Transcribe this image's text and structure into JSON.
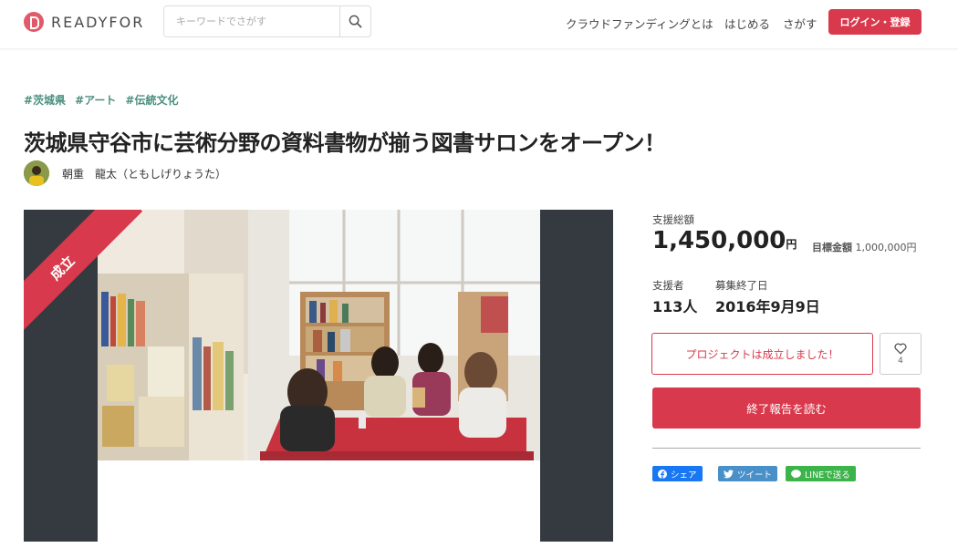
{
  "header": {
    "logo_text": "READYFOR",
    "search_placeholder": "キーワードでさがす",
    "nav": [
      "クラウドファンディングとは",
      "はじめる",
      "さがす"
    ],
    "login_label": "ログイン・登録"
  },
  "project": {
    "tags": [
      "#茨城県",
      "#アート",
      "#伝統文化"
    ],
    "title": "茨城県守谷市に芸術分野の資料書物が揃う図書サロンをオープン！",
    "owner_name": "朝重　龍太（ともしげりょうた）",
    "ribbon": "成立"
  },
  "stats": {
    "total_label": "支援総額",
    "total_value": "1,450,000",
    "total_unit": "円",
    "goal_label": "目標金額",
    "goal_value": "1,000,000円",
    "supporters_label": "支援者",
    "supporters_value": "113人",
    "end_label": "募集終了日",
    "end_value": "2016年9月9日"
  },
  "actions": {
    "status_label": "プロジェクトは成立しました！",
    "favorite_count": "4",
    "report_label": "終了報告を読む"
  },
  "share": {
    "facebook": "シェア",
    "twitter": "ツイート",
    "line": "LINEで送る"
  },
  "colors": {
    "brand_red": "#d9394c",
    "tag_green": "#4a8f7e",
    "facebook": "#1877f2",
    "twitter": "#4a90c8",
    "line": "#3cb449"
  }
}
